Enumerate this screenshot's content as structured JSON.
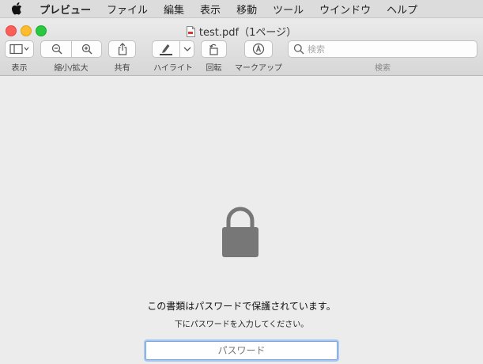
{
  "menubar": {
    "items": [
      "プレビュー",
      "ファイル",
      "編集",
      "表示",
      "移動",
      "ツール",
      "ウインドウ",
      "ヘルプ"
    ]
  },
  "window": {
    "title": "test.pdf（1ページ）"
  },
  "toolbar": {
    "view_label": "表示",
    "zoom_label": "縮小/拡大",
    "share_label": "共有",
    "highlight_label": "ハイライト",
    "rotate_label": "回転",
    "markup_label": "マークアップ",
    "search_label": "検索",
    "search_placeholder": "検索"
  },
  "content": {
    "message": "この書類はパスワードで保護されています。",
    "instruction": "下にパスワードを入力してください。",
    "password_placeholder": "パスワード",
    "lock_color": "#777777"
  }
}
